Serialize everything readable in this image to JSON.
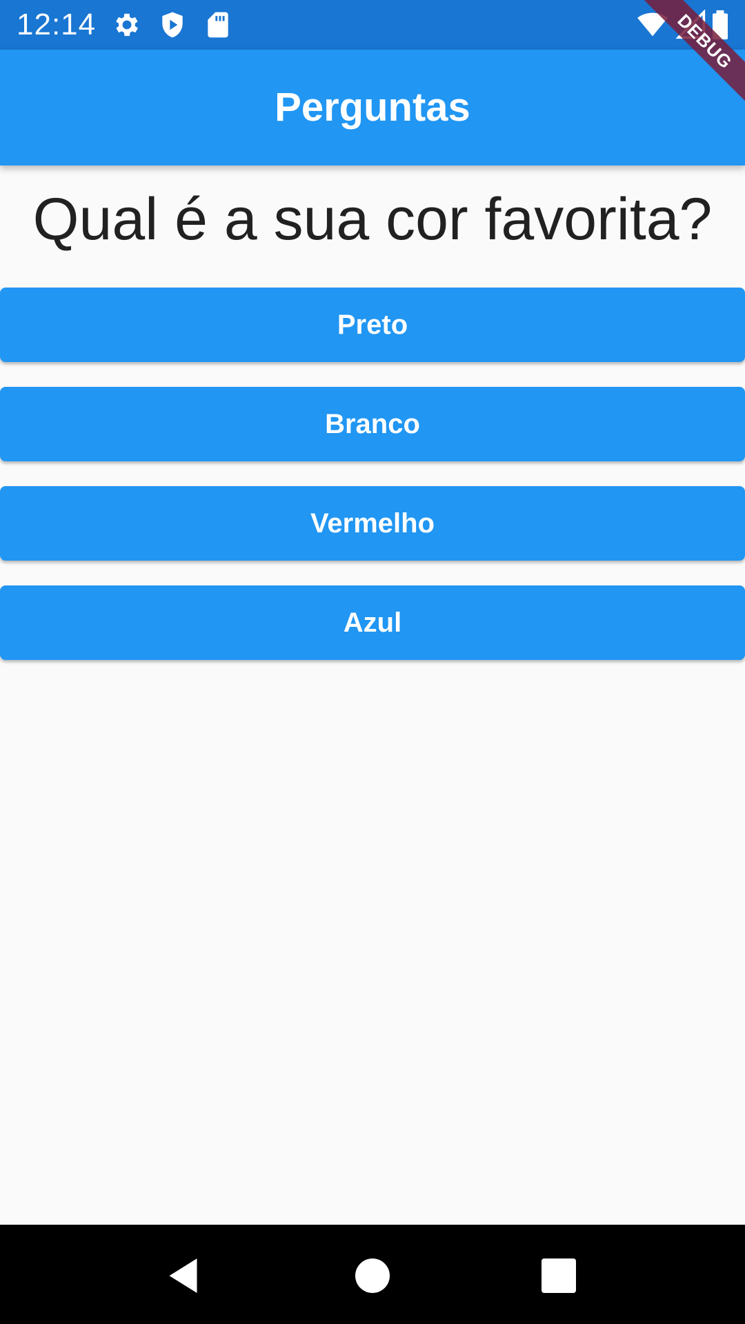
{
  "status_bar": {
    "time": "12:14",
    "left_icons": [
      "gear-icon",
      "shield-play-icon",
      "sd-card-icon"
    ],
    "right_icons": [
      "wifi-icon",
      "signal-icon",
      "battery-icon"
    ]
  },
  "debug_banner": {
    "label": "DEBUG"
  },
  "app_bar": {
    "title": "Perguntas"
  },
  "question": {
    "text": "Qual é a sua cor favorita?"
  },
  "answers": [
    {
      "label": "Preto"
    },
    {
      "label": "Branco"
    },
    {
      "label": "Vermelho"
    },
    {
      "label": "Azul"
    }
  ],
  "nav_bar": {
    "buttons": [
      "back-icon",
      "home-icon",
      "recents-icon"
    ]
  },
  "colors": {
    "status_bar": "#1976D2",
    "primary": "#2196F3",
    "background": "#FAFAFA",
    "question_text": "#212121"
  }
}
